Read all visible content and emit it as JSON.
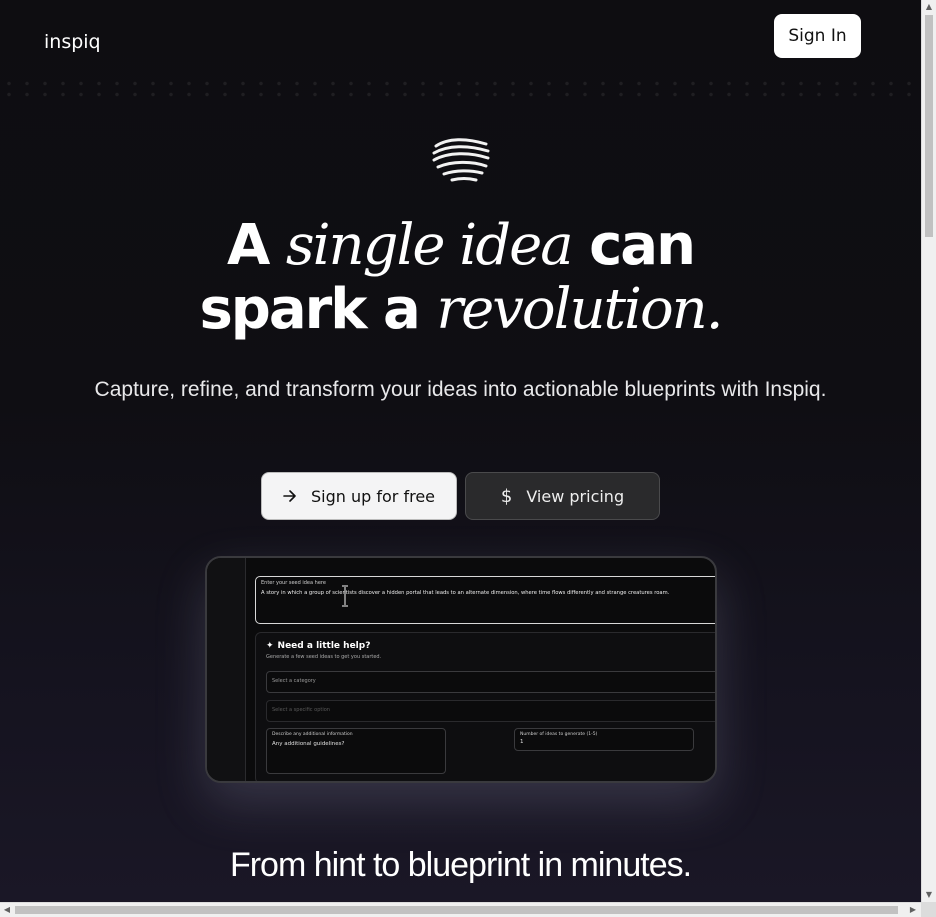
{
  "nav": {
    "logo": "inspiq",
    "signin_label": "Sign In"
  },
  "hero": {
    "headline_1": "A ",
    "headline_2": "single idea",
    "headline_3": " can",
    "headline_4": "spark a ",
    "headline_5": "revolution.",
    "subtitle": "Capture, refine, and transform your ideas into actionable blueprints with Inspiq.",
    "signup_label": "Sign up for free",
    "signup_icon": "arrow-right-icon",
    "pricing_label": "View pricing",
    "pricing_icon": "dollar-icon"
  },
  "preview": {
    "idea_label": "Enter your seed idea here",
    "idea_text": "A story in which a group of scientists discover a hidden portal that leads to an alternate dimension, where time flows differently and strange creatures roam.",
    "help_title": "Need a little help?",
    "help_sub": "Generate a few seed ideas to get you started.",
    "category_placeholder": "Select a category",
    "option_placeholder": "Select a specific option",
    "info_label": "Describe any additional information",
    "info_value": "Any additional guidelines?",
    "count_label": "Number of ideas to generate (1-5)",
    "count_value": "1"
  },
  "section": {
    "title": "From hint to blueprint in minutes."
  },
  "colors": {
    "background": "#0e0d11",
    "accent_light": "#f4f4f5",
    "button_dark": "#2a2a2c"
  }
}
